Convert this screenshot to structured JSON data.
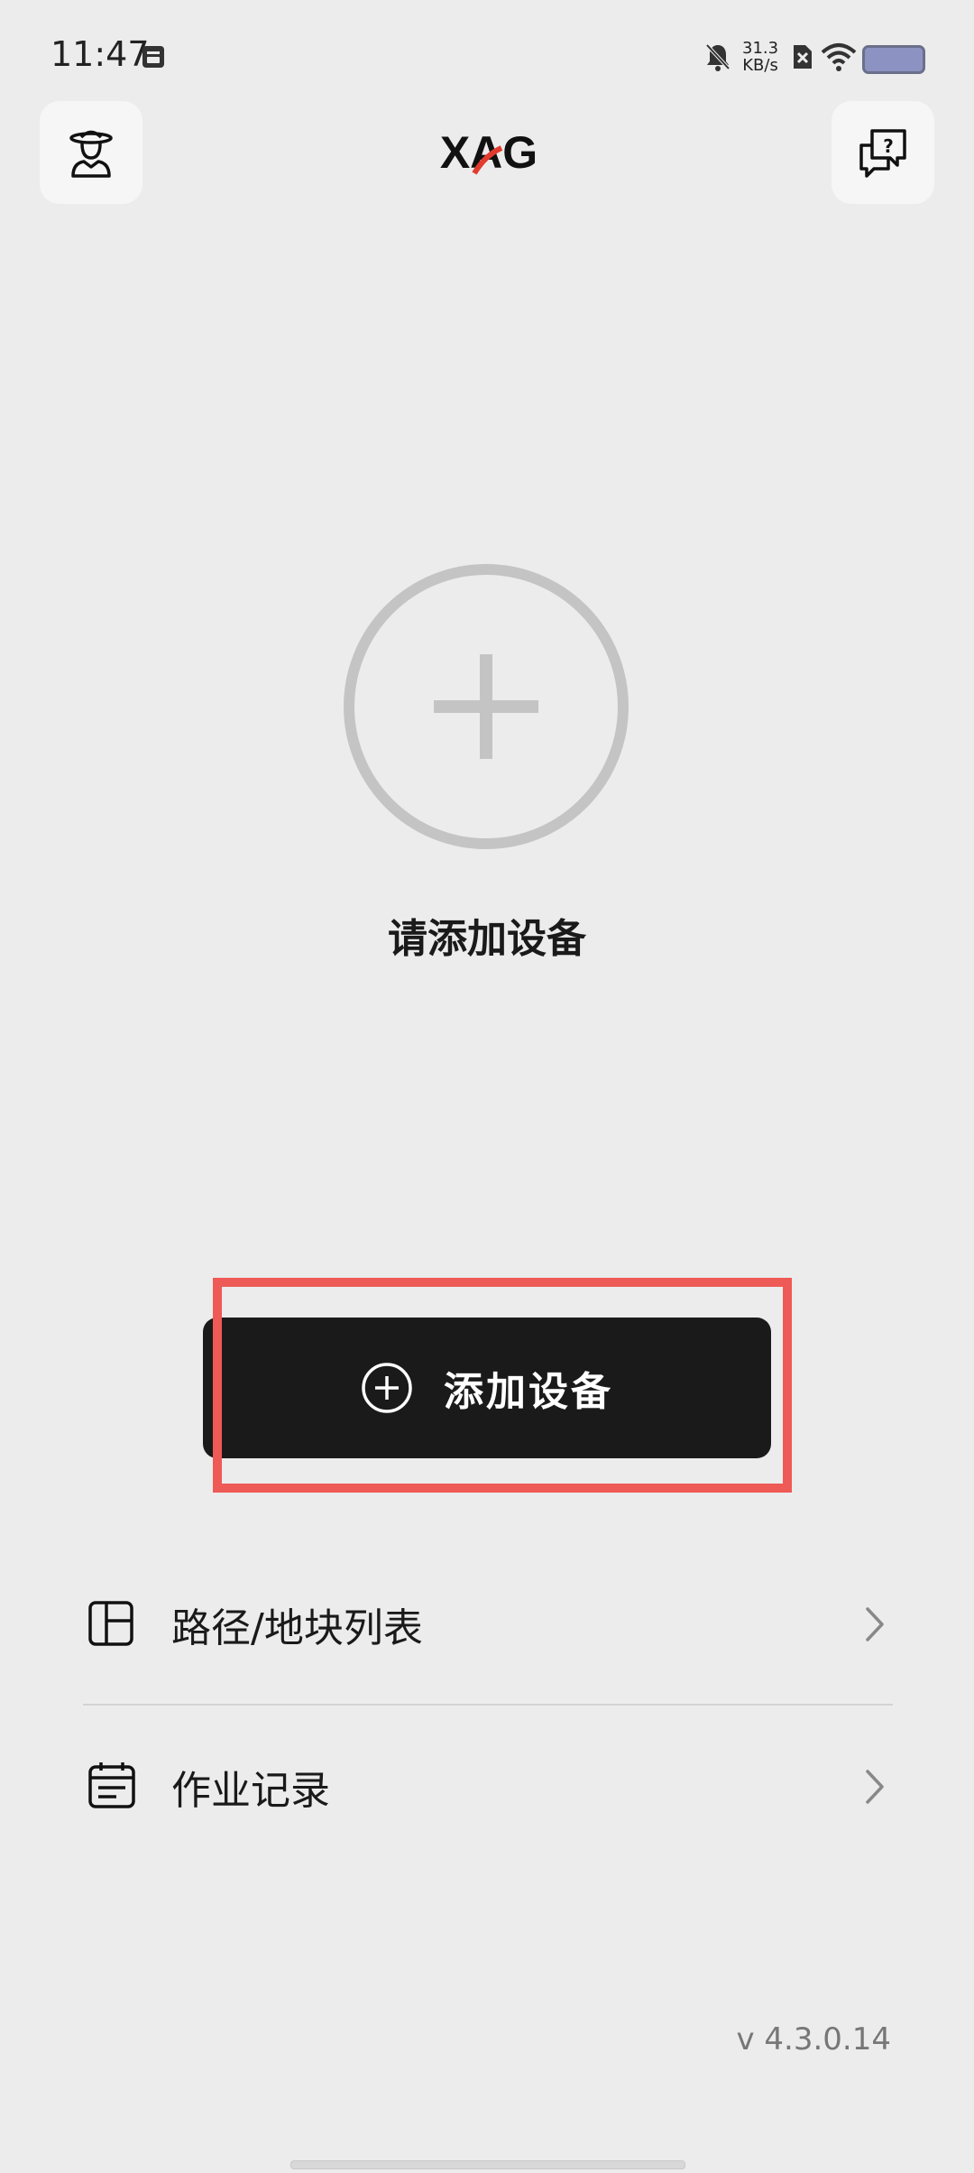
{
  "status_bar": {
    "time": "11:47",
    "net_speed_value": "31.3",
    "net_speed_unit": "KB/s",
    "icons": [
      "screenshot-icon",
      "bell-off-icon",
      "sim-none-icon",
      "wifi-icon",
      "battery-icon"
    ]
  },
  "header": {
    "logo_text": "XAG",
    "left_icon": "user-farmer-icon",
    "right_icon": "help-chat-icon"
  },
  "empty_state": {
    "icon": "plus-circle-icon",
    "text": "请添加设备"
  },
  "add_button": {
    "label": "添加设备",
    "icon": "plus-circle-icon"
  },
  "menu": [
    {
      "label": "路径/地块列表",
      "icon": "layout-panel-icon"
    },
    {
      "label": "作业记录",
      "icon": "calendar-list-icon"
    }
  ],
  "version": "v 4.3.0.14",
  "colors": {
    "background": "#ececec",
    "button_bg": "#1b1a1a",
    "highlight": "#ee5a56",
    "logo_accent": "#e23b2e"
  }
}
